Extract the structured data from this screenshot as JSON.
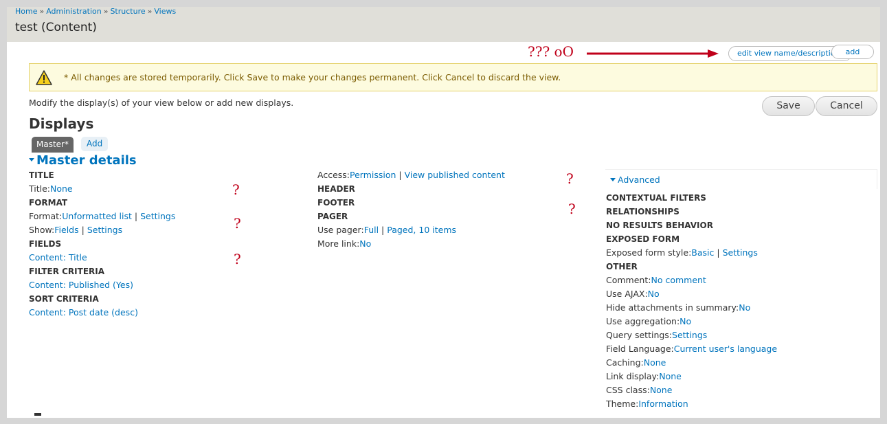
{
  "breadcrumb": {
    "home": "Home",
    "administration": "Administration",
    "structure": "Structure",
    "views": "Views",
    "separator": "»"
  },
  "page_title": "test (Content)",
  "annotation": {
    "text": "??? oO",
    "color": "#c0001a"
  },
  "top_buttons": {
    "edit_view_name": "edit view name/description",
    "add": "add"
  },
  "warning": {
    "message": "* All changes are stored temporarily. Click Save to make your changes permanent. Click Cancel to discard the view.",
    "icon": "warning-triangle-icon"
  },
  "modify_text": "Modify the display(s) of your view below or add new displays.",
  "actions": {
    "save": "Save",
    "cancel": "Cancel"
  },
  "displays": {
    "heading": "Displays",
    "tabs": {
      "master": "Master*",
      "add": "Add"
    },
    "master_details": "Master details"
  },
  "left_column": {
    "title_head": "TITLE",
    "title_label": "Title:",
    "title_value": "None",
    "format_head": "FORMAT",
    "format_label": "Format:",
    "format_value": "Unformatted list",
    "format_settings": "Settings",
    "show_label": "Show:",
    "show_value": "Fields",
    "show_settings": "Settings",
    "fields_head": "FIELDS",
    "field_item": "Content: Title",
    "filter_head": "FILTER CRITERIA",
    "filter_item": "Content: Published (Yes)",
    "sort_head": "SORT CRITERIA",
    "sort_item": "Content: Post date (desc)"
  },
  "middle_column": {
    "access_label": "Access:",
    "access_value": "Permission",
    "access_extra": "View published content",
    "header_head": "HEADER",
    "footer_head": "FOOTER",
    "pager_head": "PAGER",
    "pager_label": "Use pager:",
    "pager_value": "Full",
    "pager_extra": "Paged, 10 items",
    "more_link_label": "More link:",
    "more_link_value": "No"
  },
  "right_column": {
    "advanced": "Advanced",
    "contextual_filters_head": "CONTEXTUAL FILTERS",
    "relationships_head": "RELATIONSHIPS",
    "no_results_head": "NO RESULTS BEHAVIOR",
    "exposed_form_head": "EXPOSED FORM",
    "exposed_style_label": "Exposed form style:",
    "exposed_style_value": "Basic",
    "exposed_style_settings": "Settings",
    "other_head": "OTHER",
    "comment_label": "Comment:",
    "comment_value": "No comment",
    "ajax_label": "Use AJAX:",
    "ajax_value": "No",
    "hide_attach_label": "Hide attachments in summary:",
    "hide_attach_value": "No",
    "aggregation_label": "Use aggregation:",
    "aggregation_value": "No",
    "query_label": "Query settings:",
    "query_value": "Settings",
    "field_lang_label": "Field Language:",
    "field_lang_value": "Current user's language",
    "caching_label": "Caching:",
    "caching_value": "None",
    "link_display_label": "Link display:",
    "link_display_value": "None",
    "css_class_label": "CSS class:",
    "css_class_value": "None",
    "theme_label": "Theme:",
    "theme_value": "Information"
  },
  "question_marks": [
    "?",
    "?",
    "?",
    "?",
    "?",
    "?"
  ]
}
